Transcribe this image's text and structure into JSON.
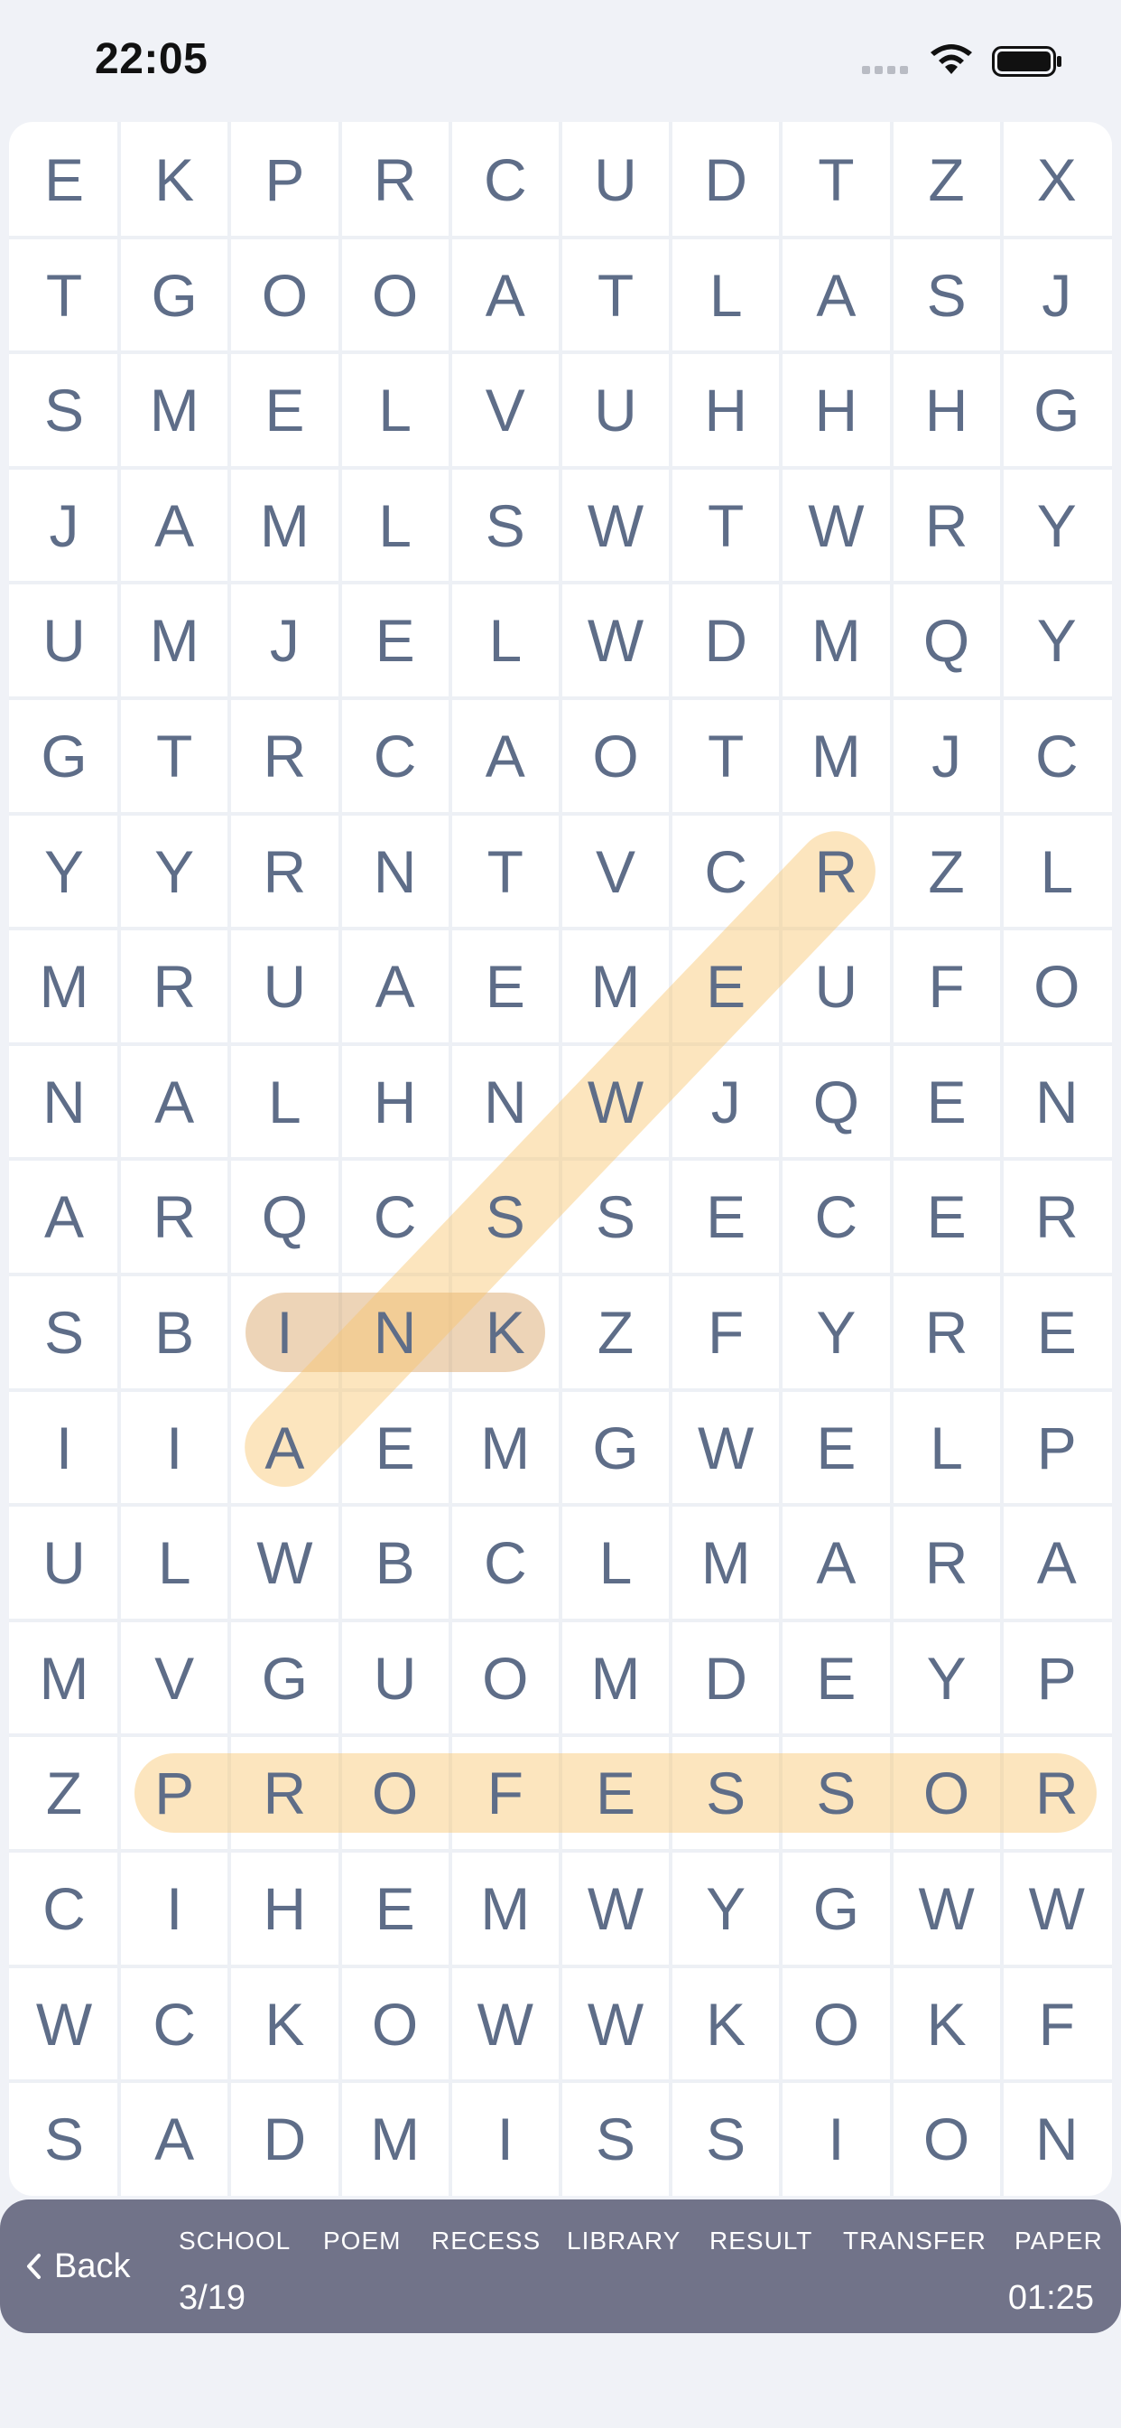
{
  "status_bar": {
    "time": "22:05"
  },
  "grid": {
    "rows": [
      "EKPRCUDTZX",
      "TGOOATLASJ",
      "SMELVUHHHG",
      "JAMLSWTWRY",
      "UMJELWDMQY",
      "GTRCAOTMJC",
      "YYRNTVCRZL",
      "MRUAEMEUFO",
      "NALHNWJQEN",
      "ARQCSSECER",
      "SBINKZFYRE",
      "IIAEMGWELP",
      "ULWBCLMARA",
      "MVGUOMDEYP",
      "ZPROFESSOR",
      "CIHEMWYGWW",
      "WCKOWWKOKF",
      "SADMISSION"
    ]
  },
  "found_words": [
    {
      "word": "PROFESSOR",
      "start": [
        14,
        1
      ],
      "end": [
        14,
        9
      ],
      "color": "#f8c56e"
    },
    {
      "word": "INK",
      "start": [
        10,
        2
      ],
      "end": [
        10,
        4
      ],
      "color": "#d6a060"
    },
    {
      "word": "ANSWER",
      "start": [
        11,
        2
      ],
      "end": [
        6,
        7
      ],
      "color": "#f8c56e"
    }
  ],
  "bottom_bar": {
    "back_label": "Back",
    "words": [
      "SCHOOL",
      "POEM",
      "RECESS",
      "LIBRARY",
      "RESULT",
      "TRANSFER",
      "PAPER"
    ],
    "progress": "3/19",
    "timer": "01:25"
  }
}
